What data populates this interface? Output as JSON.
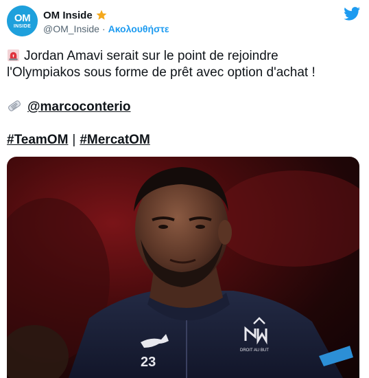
{
  "account": {
    "avatar_line1": "OM",
    "avatar_line2": "INSIDE",
    "display_name": "OM Inside",
    "badge_icon": "star-icon",
    "handle": "@OM_Inside",
    "separator": "·",
    "follow_label": "Ακολουθήστε"
  },
  "tweet": {
    "line1": "Jordan Amavi serait sur le point de rejoindre",
    "line2": "l'Olympiakos sous forme de prêt avec option d'achat !",
    "mention": "@marcoconterio",
    "hashtag1": "#TeamOM",
    "hashtag_separator": "|",
    "hashtag2": "#MercatOM"
  },
  "media": {
    "jersey_number": "23",
    "crest_text": "DROIT AU BUT"
  },
  "colors": {
    "accent": "#1d9bf0",
    "avatar_bg": "#1ea0dc",
    "star": "#f4a81d"
  }
}
